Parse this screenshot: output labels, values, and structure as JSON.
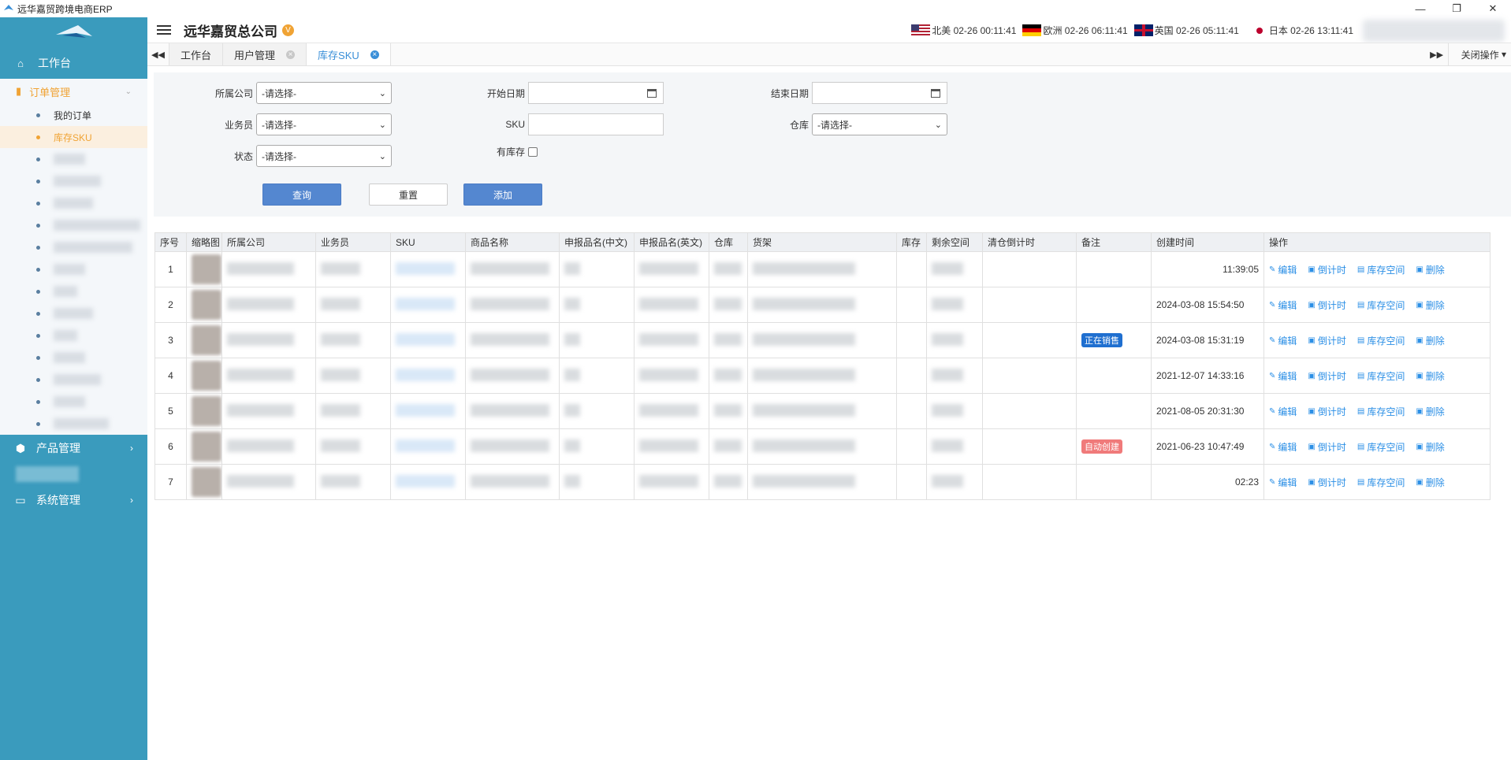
{
  "window": {
    "title": "远华嘉贸跨境电商ERP",
    "controls": [
      "—",
      "❐",
      "✕"
    ]
  },
  "sidebar": {
    "workbench": "工作台",
    "orders": {
      "label": "订单管理",
      "items": [
        {
          "label": "我的订单",
          "active": false
        },
        {
          "label": "库存SKU",
          "active": true
        }
      ]
    },
    "product": "产品管理",
    "system": "系统管理"
  },
  "header": {
    "company": "远华嘉贸总公司",
    "badge": "V",
    "clocks": [
      {
        "flag": "us",
        "text": "北美 02-26 00:11:41"
      },
      {
        "flag": "de",
        "text": "欧洲 02-26 06:11:41"
      },
      {
        "flag": "gb",
        "text": "英国 02-26 05:11:41"
      },
      {
        "flag": "jp",
        "text": "日本 02-26 13:11:41"
      }
    ]
  },
  "tabs": {
    "items": [
      {
        "label": "工作台",
        "closable": false
      },
      {
        "label": "用户管理",
        "closable": true
      },
      {
        "label": "库存SKU",
        "closable": true,
        "active": true
      }
    ],
    "close_ops": "关闭操作"
  },
  "filter": {
    "company_label": "所属公司",
    "start_date_label": "开始日期",
    "end_date_label": "结束日期",
    "salesman_label": "业务员",
    "sku_label": "SKU",
    "warehouse_label": "仓库",
    "status_label": "状态",
    "has_stock_label": "有库存",
    "select_placeholder": "-请选择-",
    "query_btn": "查询",
    "reset_btn": "重置",
    "add_btn": "添加"
  },
  "table": {
    "columns": [
      "序号",
      "缩略图",
      "所属公司",
      "业务员",
      "SKU",
      "商品名称",
      "申报品名(中文)",
      "申报品名(英文)",
      "仓库",
      "货架",
      "库存",
      "剩余空间",
      "清仓倒计时",
      "备注",
      "创建时间",
      "操作"
    ],
    "rows": [
      {
        "no": "1",
        "note": "",
        "created": "11:39:05"
      },
      {
        "no": "2",
        "note": "",
        "created": "2024-03-08 15:54:50"
      },
      {
        "no": "3",
        "note": "正在销售",
        "note_color": "blue",
        "created": "2024-03-08 15:31:19"
      },
      {
        "no": "4",
        "note": "",
        "created": "2021-12-07 14:33:16"
      },
      {
        "no": "5",
        "note": "",
        "created": "2021-08-05 20:31:30"
      },
      {
        "no": "6",
        "note": "自动创建",
        "note_color": "red",
        "created": "2021-06-23 10:47:49"
      },
      {
        "no": "7",
        "note": "",
        "created": "02:23"
      }
    ],
    "actions": {
      "edit": "编辑",
      "countdown": "倒计时",
      "space": "库存空间",
      "delete": "删除"
    }
  },
  "colors": {
    "sidebar": "#3a9bbd",
    "accent": "#f0a334",
    "primary": "#5487d0",
    "link": "#2b8fe6"
  }
}
